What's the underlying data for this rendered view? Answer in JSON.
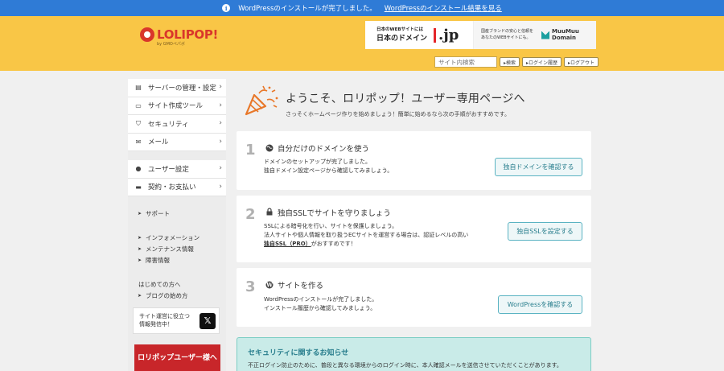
{
  "notice": {
    "text": "WordPressのインストールが完了しました。",
    "link": "WordPressのインストール結果を見る"
  },
  "header": {
    "logo_word": "LOLIPOP!",
    "logo_sub": "by GMOペパボ",
    "banner": {
      "domain_line1": "日本のWEBサイトには",
      "domain_line2": "日本のドメイン",
      "domain_tld": ".jp",
      "muumuu_line1": "国産ブランドの安心と信頼を",
      "muumuu_line2": "あなたのWEBサイトにも。",
      "muumuu_name1": "MuuMuu",
      "muumuu_name2": "Domain"
    },
    "search_placeholder": "サイト内検索",
    "search_button": "▸検索",
    "login_history": "▸ログイン履歴",
    "logout": "▸ログアウト"
  },
  "sidebar": {
    "items": [
      {
        "icon": "server-icon",
        "glyph": "▤",
        "label": "サーバーの管理・設定"
      },
      {
        "icon": "monitor-icon",
        "glyph": "▭",
        "label": "サイト作成ツール"
      },
      {
        "icon": "shield-icon",
        "glyph": "⛉",
        "label": "セキュリティ"
      },
      {
        "icon": "mail-icon",
        "glyph": "✉",
        "label": "メール"
      }
    ],
    "items2": [
      {
        "icon": "user-icon",
        "glyph": "●",
        "label": "ユーザー設定"
      },
      {
        "icon": "card-icon",
        "glyph": "▬",
        "label": "契約・お支払い"
      }
    ],
    "links": {
      "support": "サポート",
      "information": "インフォメーション",
      "maintenance": "メンテナンス情報",
      "trouble": "障害情報",
      "beginners": "はじめての方へ",
      "blog_start": "ブログの始め方"
    },
    "x_box": {
      "line1": "サイト運営に役立つ",
      "line2": "情報発信中！",
      "logo": "𝕏"
    },
    "promo": "ロリポップユーザー様へ"
  },
  "welcome": {
    "title": "ようこそ、ロリポップ！ユーザー専用ページへ",
    "lead": "さっそくホームページ作りを始めましょう！簡単に始めるなら次の手順がおすすめです。"
  },
  "steps": [
    {
      "num": "1",
      "icon": "globe-icon",
      "title": "自分だけのドメインを使う",
      "line1": "ドメインのセットアップが完了しました。",
      "line2": "独自ドメイン設定ページから確認してみましょう。",
      "button": "独自ドメインを確認する"
    },
    {
      "num": "2",
      "icon": "lock-icon",
      "title": "独自SSLでサイトを守りましょう",
      "line1": "SSLによる暗号化を行い、サイトを保護しましょう。",
      "line2": "法人サイトや個人情報を取り扱うECサイトを運営する場合は、認証レベルの高い",
      "line3_strong": "独自SSL（PRO）",
      "line3_rest": "がおすすめです！",
      "button": "独自SSLを設定する"
    },
    {
      "num": "3",
      "icon": "wordpress-icon",
      "title": "サイトを作る",
      "line1": "WordPressのインストールが完了しました。",
      "line2": "インストール履歴から確認してみましょう。",
      "button": "WordPressを確認する"
    }
  ],
  "security_notice": {
    "title": "セキュリティに関するお知らせ",
    "body": "不正ログイン防止のために、普段と異なる環境からのログイン時に、本人確認メールを送信させていただくことがあります。"
  }
}
